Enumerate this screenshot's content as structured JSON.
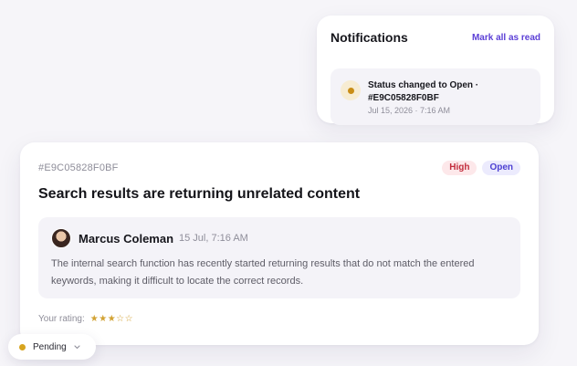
{
  "notifications": {
    "title": "Notifications",
    "mark_all": "Mark all as read",
    "items": [
      {
        "text": "Status changed to Open · #E9C05828F0BF",
        "time": "Jul 15, 2026 · 7:16 AM",
        "icon": "dot-icon",
        "accent": "#c98d16"
      }
    ]
  },
  "ticket": {
    "id": "#E9C05828F0BF",
    "priority": "High",
    "status": "Open",
    "title": "Search results are returning unrelated content",
    "comment": {
      "author": "Marcus Coleman",
      "time": "15 Jul, 7:16 AM",
      "text": "The internal search function has recently started returning results that do not match the entered keywords, making it difficult to locate the correct records."
    },
    "rating_label": "Your rating:",
    "rating_stars": "★★★☆☆",
    "rating_value": 3,
    "rating_max": 5
  },
  "status_selector": {
    "value": "Pending",
    "color": "#d7a41f"
  },
  "colors": {
    "accent": "#5b3fd6",
    "high": "#c22c3c",
    "open": "#4c3fd2",
    "star": "#d2a233"
  }
}
